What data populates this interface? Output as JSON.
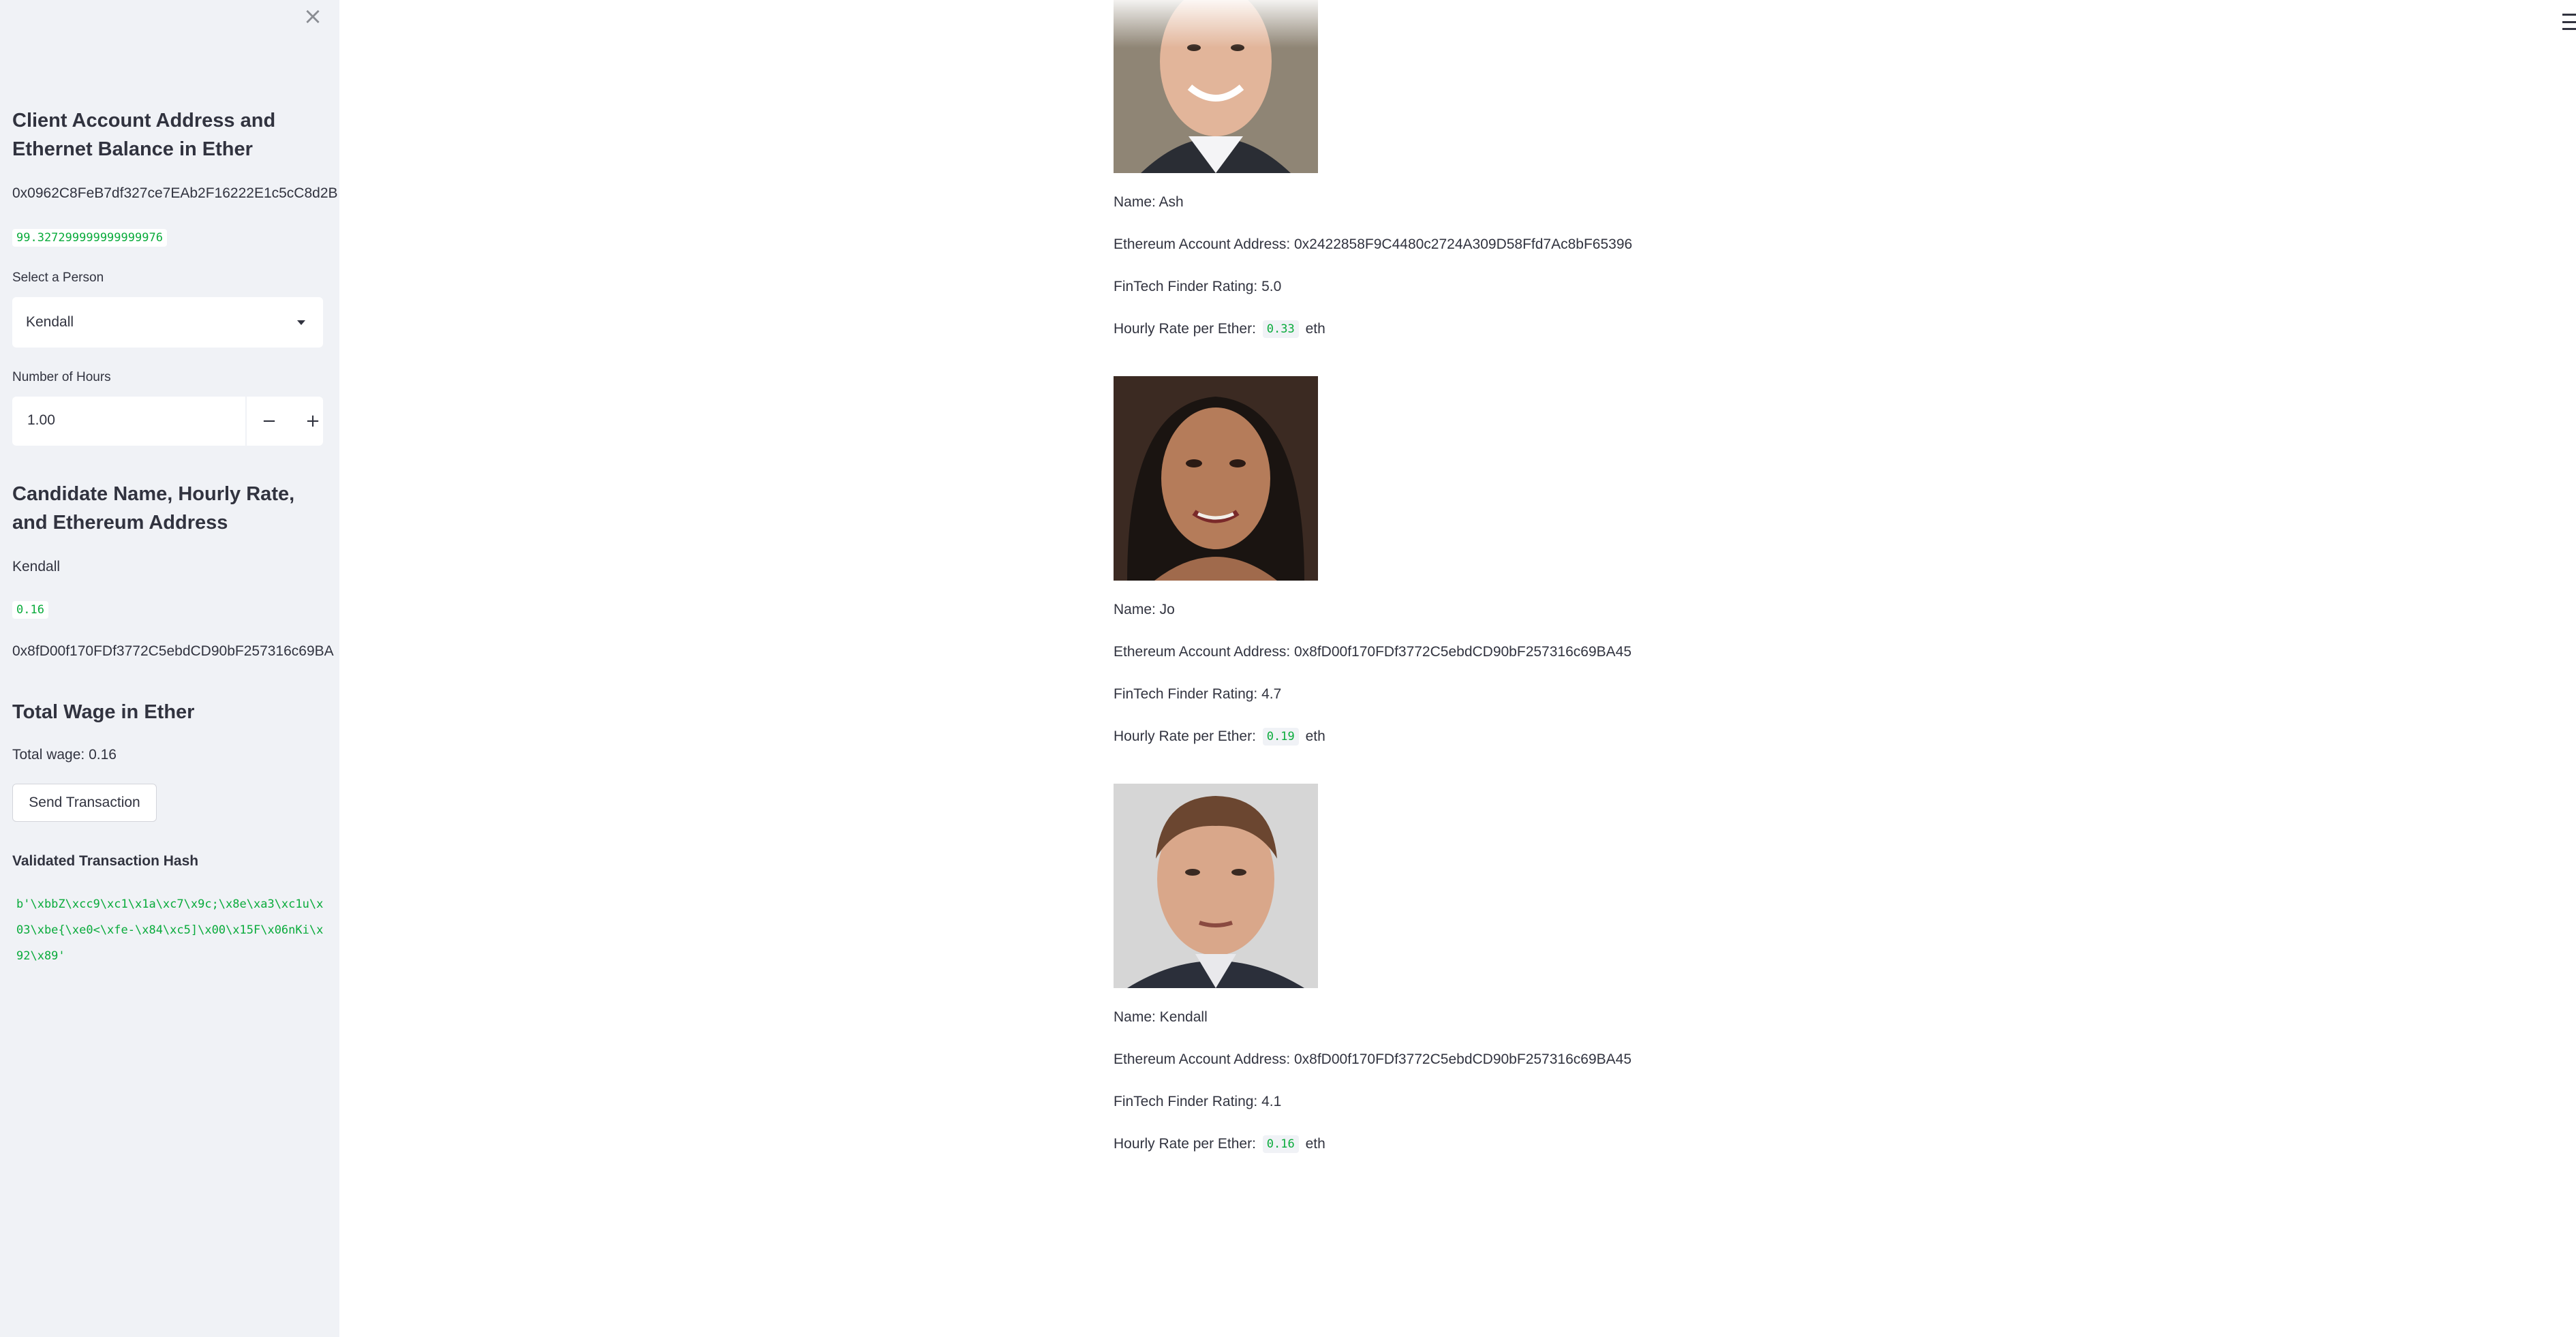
{
  "sidebar": {
    "close_label": "×",
    "client_heading": "Client Account Address and Ethernet Balance in Ether",
    "client_address": "0x0962C8FeB7df327ce7EAb2F16222E1c5cC8d2B",
    "client_balance": "99.327299999999999976",
    "select_label": "Select a Person",
    "select_value": "Kendall",
    "hours_label": "Number of Hours",
    "hours_value": "1.00",
    "minus_label": "−",
    "plus_label": "+",
    "candidate_heading": "Candidate Name, Hourly Rate, and Ethereum Address",
    "candidate_name": "Kendall",
    "candidate_rate": "0.16",
    "candidate_address": "0x8fD00f170FDf3772C5ebdCD90bF257316c69BA",
    "total_heading": "Total Wage in Ether",
    "total_wage": "Total wage: 0.16",
    "send_button": "Send Transaction",
    "hash_label": "Validated Transaction Hash",
    "hash_value": "b'\\xbbZ\\xcc9\\xc1\\x1a\\xc7\\x9c;\\x8e\\xa3\\xc1u\\x03\\xbe{\\xe0<\\xfe-\\x84\\xc5]\\x00\\x15F\\x06nKi\\x92\\x89'"
  },
  "candidates": [
    {
      "name": "Name: Ash",
      "address": "Ethereum Account Address: 0x2422858F9C4480c2724A309D58Ffd7Ac8bF65396",
      "rating": "FinTech Finder Rating: 5.0",
      "rate_label": "Hourly Rate per Ether:",
      "rate_value": "0.33",
      "rate_unit": "eth"
    },
    {
      "name": "Name: Jo",
      "address": "Ethereum Account Address: 0x8fD00f170FDf3772C5ebdCD90bF257316c69BA45",
      "rating": "FinTech Finder Rating: 4.7",
      "rate_label": "Hourly Rate per Ether:",
      "rate_value": "0.19",
      "rate_unit": "eth"
    },
    {
      "name": "Name: Kendall",
      "address": "Ethereum Account Address: 0x8fD00f170FDf3772C5ebdCD90bF257316c69BA45",
      "rating": "FinTech Finder Rating: 4.1",
      "rate_label": "Hourly Rate per Ether:",
      "rate_value": "0.16",
      "rate_unit": "eth"
    }
  ],
  "colors": {
    "sidebar_bg": "#f0f2f6",
    "code_green": "#09ab3b",
    "text": "#31333f"
  }
}
